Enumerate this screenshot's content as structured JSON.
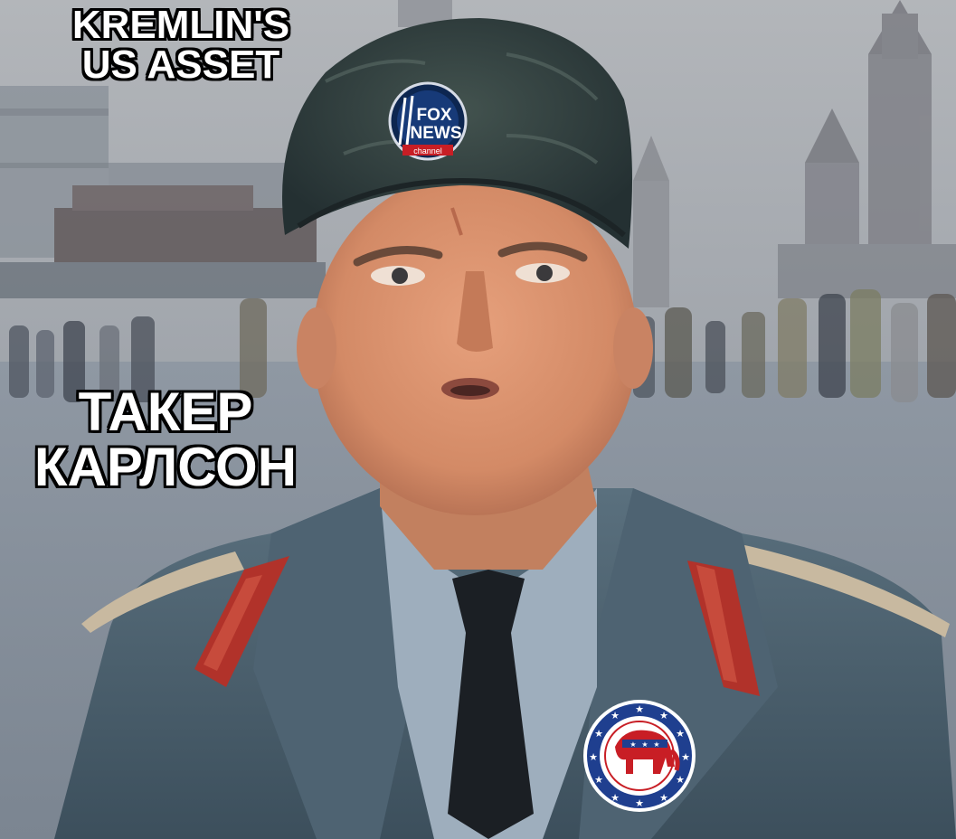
{
  "caption_top": {
    "line1": "KREMLIN'S",
    "line2": "US ASSET"
  },
  "caption_mid": {
    "line1": "ТАКЕР",
    "line2": "КАРЛСОН"
  },
  "badges": {
    "fox": {
      "line1": "FOX",
      "line2": "NEWS",
      "line3": "channel"
    }
  },
  "colors": {
    "sky": "#a7abb1",
    "square": "#8a929c",
    "coat": "#4a5e6c",
    "hat": "#2e3c40",
    "red_tab": "#b1322a",
    "gop_blue": "#1f3f8f",
    "gop_red": "#c81e25"
  },
  "icons": [
    "fox-news-badge-icon",
    "republican-elephant-badge-icon"
  ]
}
